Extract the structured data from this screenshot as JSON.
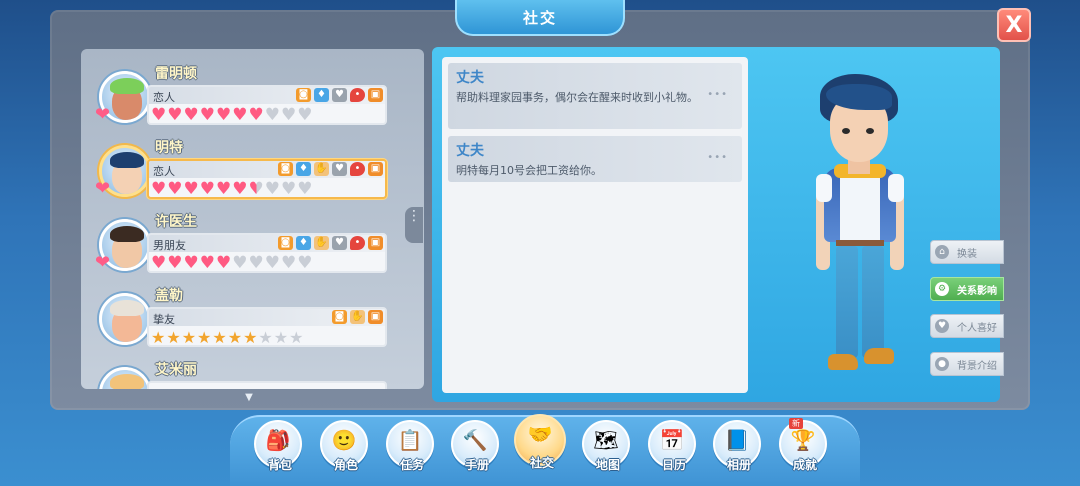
{
  "window": {
    "title": "社交",
    "close_label": "X"
  },
  "npcs": [
    {
      "name": "雷明顿",
      "relation": "恋人",
      "icons": [
        "photo-icon",
        "shirt-icon",
        "heart-icon",
        "talk-icon",
        "gift-icon"
      ],
      "rating": {
        "kind": "hearts",
        "filled": 7,
        "total": 10
      }
    },
    {
      "name": "明特",
      "relation": "恋人",
      "icons": [
        "photo-icon",
        "shirt-icon",
        "hand-icon",
        "heart-icon",
        "talk-icon",
        "gift-icon"
      ],
      "rating": {
        "kind": "hearts",
        "filled": 6.5,
        "total": 10
      }
    },
    {
      "name": "许医生",
      "relation": "男朋友",
      "icons": [
        "photo-icon",
        "shirt-icon",
        "hand-icon",
        "heart-icon",
        "talk-icon",
        "gift-icon"
      ],
      "rating": {
        "kind": "hearts",
        "filled": 5,
        "total": 10
      }
    },
    {
      "name": "盖勒",
      "relation": "挚友",
      "icons": [
        "photo-icon",
        "hand-icon",
        "gift-icon"
      ],
      "rating": {
        "kind": "stars",
        "filled": 7,
        "total": 10
      }
    },
    {
      "name": "艾米丽"
    }
  ],
  "effects": [
    {
      "title": "丈夫",
      "desc": "帮助料理家园事务，偶尔会在醒来时收到小礼物。"
    },
    {
      "title": "丈夫",
      "desc": "明特每月10号会把工资给你。"
    }
  ],
  "side_buttons": [
    {
      "label": "换装",
      "icon": "hanger-icon"
    },
    {
      "label": "关系影响",
      "icon": "gear-icon"
    },
    {
      "label": "个人喜好",
      "icon": "heart-icon"
    },
    {
      "label": "背景介绍",
      "icon": "person-icon"
    }
  ],
  "nav": [
    {
      "label": "背包",
      "glyph": "🎒"
    },
    {
      "label": "角色",
      "glyph": "🙂"
    },
    {
      "label": "任务",
      "glyph": "📋"
    },
    {
      "label": "手册",
      "glyph": "🔨"
    },
    {
      "label": "社交",
      "glyph": "🤝"
    },
    {
      "label": "地图",
      "glyph": "🗺"
    },
    {
      "label": "日历",
      "glyph": "📅"
    },
    {
      "label": "相册",
      "glyph": "📘"
    },
    {
      "label": "成就",
      "glyph": "🏆",
      "badge": "新"
    }
  ],
  "colors": {
    "accent": "#4dc6f2",
    "selected": "#f6b94c",
    "active_side": "#4fae4f",
    "close": "#e2524a"
  }
}
